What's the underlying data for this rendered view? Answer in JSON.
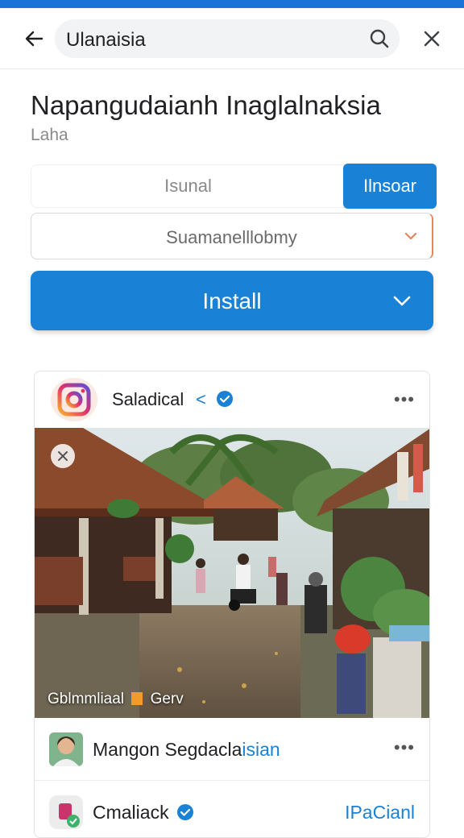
{
  "search": {
    "query": "Ulanaisia"
  },
  "header": {
    "title": "Napangudaianh Inaglalnaksia",
    "subtitle": "Laha"
  },
  "segments": {
    "left_label": "Isunal",
    "right_label": "Ilnsoar"
  },
  "dropdown": {
    "selected": "Suamanelllobmy"
  },
  "install": {
    "label": "Install"
  },
  "post": {
    "account_name": "Saladical",
    "arrow_glyph": "<",
    "more": "•••",
    "photo_caption_left": "Gblmmliaal",
    "photo_caption_right": "Gerv",
    "rows": [
      {
        "name_black": "Mangon Segdacla",
        "name_blue": "isian",
        "more": "•••"
      },
      {
        "name_black": "Cmaliack",
        "action": "IPaCianl"
      }
    ]
  },
  "colors": {
    "accent": "#1a82d6",
    "status_bar": "#1a73d9",
    "dropdown_edge": "#e8835a"
  },
  "icons": [
    "back-arrow-icon",
    "search-icon",
    "close-icon",
    "chevron-down-icon",
    "instagram-logo-icon",
    "verified-badge-icon",
    "more-dots-icon"
  ]
}
